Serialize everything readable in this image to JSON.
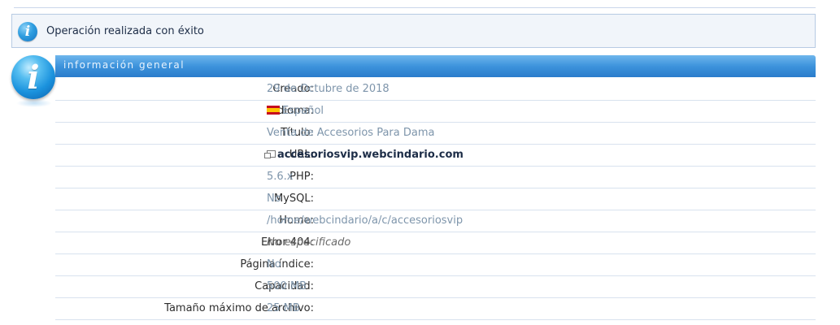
{
  "notice": {
    "text": "Operación realizada con éxito",
    "icon": "info-icon"
  },
  "panel": {
    "title": "información general",
    "rows": [
      {
        "label": "Creado:",
        "value": "29 de Octubre de 2018"
      },
      {
        "label": "Idioma:",
        "value": "Español",
        "icon": "spain-flag-icon"
      },
      {
        "label": "Título:",
        "value": "Venta de Accesorios Para Dama"
      },
      {
        "label": "URL:",
        "value": "accesoriosvip.webcindario.com",
        "icon": "external-link-icon"
      },
      {
        "label": "PHP:",
        "value": "5.6.x"
      },
      {
        "label": "MySQL:",
        "value": "No"
      },
      {
        "label": "Home:",
        "value": "/home/webcindario/a/c/accesoriosvip"
      },
      {
        "label": "Error 404:",
        "value": "No especificado"
      },
      {
        "label": "Página índice:",
        "value": "No"
      },
      {
        "label": "Capacidad:",
        "value": "500 MB"
      },
      {
        "label": "Tamaño máximo de archivo:",
        "value": "25 MB"
      }
    ]
  },
  "colors": {
    "header_blue": "#3d93dc",
    "value_text": "#7e95ab",
    "notice_bg": "#f1f5fa"
  }
}
